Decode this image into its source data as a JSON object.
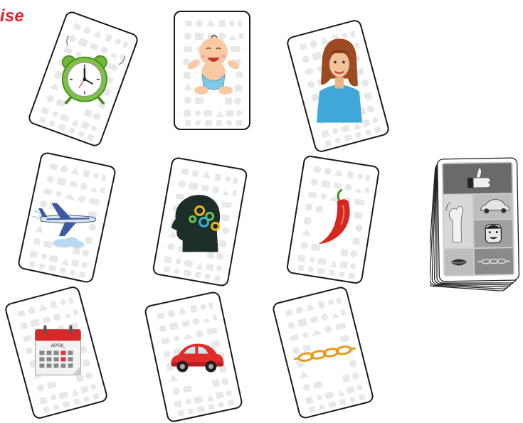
{
  "title": "ise",
  "colors": {
    "title": "#e5202b",
    "card_border": "#1a1a1a",
    "pattern": "#e8e8e8"
  },
  "cards": [
    {
      "icon": "alarm-clock-icon",
      "rotation_deg": 20
    },
    {
      "icon": "baby-icon",
      "rotation_deg": 0
    },
    {
      "icon": "woman-icon",
      "rotation_deg": -15
    },
    {
      "icon": "airplane-icon",
      "rotation_deg": 12
    },
    {
      "icon": "head-gears-icon",
      "rotation_deg": 10
    },
    {
      "icon": "chili-pepper-icon",
      "rotation_deg": 9
    },
    {
      "icon": "calendar-icon",
      "rotation_deg": -15
    },
    {
      "icon": "car-icon",
      "rotation_deg": -12
    },
    {
      "icon": "chain-icon",
      "rotation_deg": -14
    }
  ],
  "calendar": {
    "month": "APRIL"
  },
  "deck": {
    "icons": [
      "thumbs-up-icon",
      "waving-hand-icon",
      "car-icon",
      "face-icon",
      "lips-icon",
      "chain-icon"
    ]
  }
}
